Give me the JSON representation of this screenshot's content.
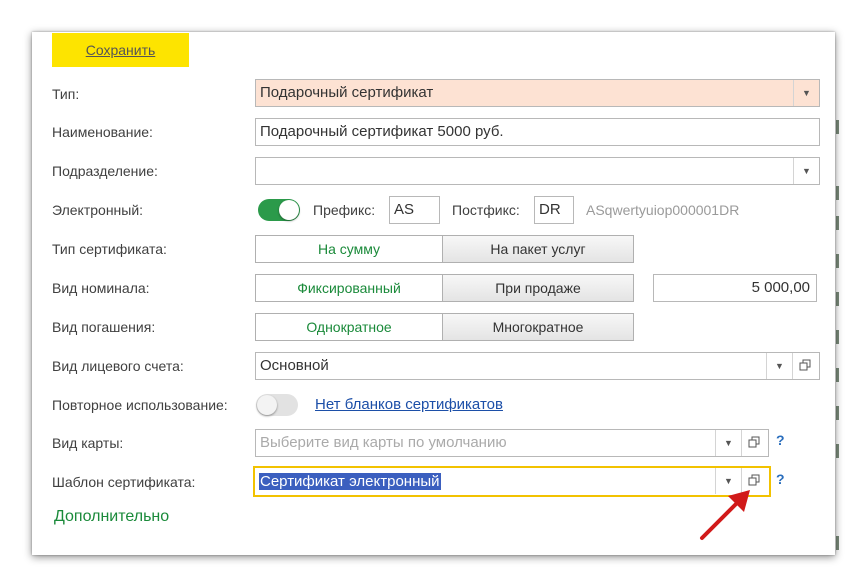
{
  "toolbar": {
    "save_label": "Сохранить"
  },
  "form": {
    "type": {
      "label": "Тип:",
      "value": "Подарочный сертификат"
    },
    "name": {
      "label": "Наименование:",
      "value": "Подарочный сертификат 5000 руб."
    },
    "division": {
      "label": "Подразделение:",
      "value": ""
    },
    "electronic": {
      "label": "Электронный:",
      "enabled": true,
      "prefix_label": "Префикс:",
      "prefix_value": "AS",
      "postfix_label": "Постфикс:",
      "postfix_value": "DR",
      "sample": "ASqwertyuiop000001DR"
    },
    "cert_type": {
      "label": "Тип сертификата:",
      "options": [
        "На сумму",
        "На пакет услуг"
      ],
      "selected": "На сумму"
    },
    "nominal": {
      "label": "Вид номинала:",
      "options": [
        "Фиксированный",
        "При продаже"
      ],
      "selected": "Фиксированный",
      "amount": "5 000,00"
    },
    "redemption": {
      "label": "Вид погашения:",
      "options": [
        "Однократное",
        "Многократное"
      ],
      "selected": "Однократное"
    },
    "account": {
      "label": "Вид лицевого счета:",
      "value": "Основной"
    },
    "reuse": {
      "label": "Повторное использование:",
      "enabled": false,
      "link": "Нет бланков сертификатов"
    },
    "card": {
      "label": "Вид карты:",
      "placeholder": "Выберите вид карты по умолчанию",
      "help": "?"
    },
    "template": {
      "label": "Шаблон сертификата:",
      "value": "Сертификат электронный",
      "help": "?"
    },
    "more_label": "Дополнительно"
  },
  "colors": {
    "accent_green": "#1a8a3a",
    "save_yellow": "#fde400",
    "focus_border": "#f2c200",
    "arrow_red": "#d11a1a"
  }
}
